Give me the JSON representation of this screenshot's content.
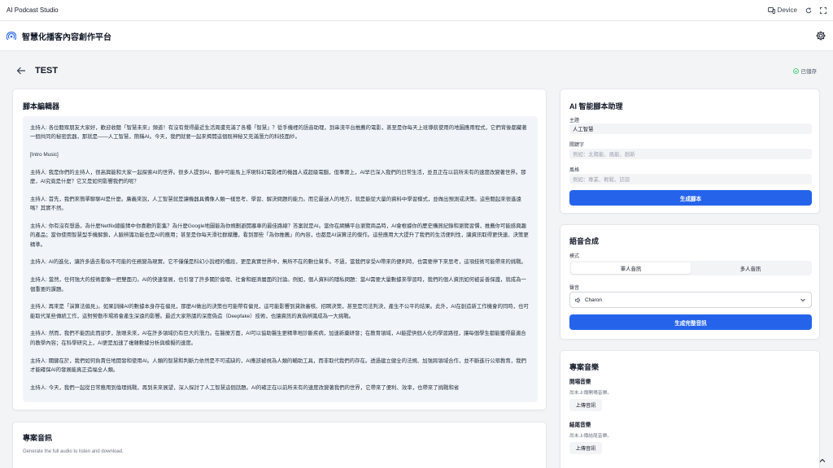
{
  "window": {
    "app_title": "AI Podcast Studio",
    "device_label": "Device"
  },
  "header": {
    "brand": "智慧化播客內容創作平台"
  },
  "page": {
    "title": "TEST",
    "saved": "已儲存"
  },
  "editor": {
    "heading": "腳本編輯器",
    "paragraphs": [
      "主持人: 各位聽眾朋友大家好，歡迎收聽「智慧未來」頻道！有沒有覺得最近生活周遭充滿了各種「智慧」？從手機裡的語音助理，到串流平台推薦的電影，甚至是你每天上班導航使用的地圖應用程式，它們背後都藏著一個共同的秘密武器，那就是——人工智慧，簡稱AI。今天，我們就要一起來揭開這個既神秘又充滿潛力的科技面紗。",
      "[Intro Music]",
      "主持人: 我是你們的主持人，很高興能和大家一起探索AI的世界。很多人提到AI，腦中可能馬上浮現科幻電影裡的機器人或超級電腦，但事實上，AI早已深入我們的日常生活，並且正在以前所未有的速度改變著世界。那麼，AI究竟是什麼？它又是如何影響我們的呢？",
      "主持人: 首先，我們來簡單聊聊AI是什麼。廣義來說，人工智慧就是讓機器具備像人類一樣思考、學習、解決問題的能力。而它最迷人的地方，就是能從大量的資料中學習模式，並做出預測或決策。這些聽起來很遙遠嗎？其實不然。",
      "主持人: 你有沒有想過，為什麼Netflix總能猜中你喜歡的影集？為什麼Google地圖能為你規劃避開塞車的最佳路線？答案就是AI。當你在網購平台瀏覽商品時，AI會根據你的歷史購買紀錄和瀏覽習慣，推薦你可能感興趣的產品；當你使用智慧型手機解鎖，人臉辨識功能也是AI的應用；甚至是你每天滑社群媒體，看到那些「為你推薦」的內容，也都是AI演算法的傑作。這些應用大大提升了我們的生活便利性，讓資訊取得更快速、決策更精準。",
      "主持人: AI的進化，讓許多過去看似不可能的任務變為現實。它不僅僅是科幻小說裡的橋段，更是真實世界中，無所不在的數位幫手。不過，當我們享受AI帶來的便利時，也需要停下來思考，這項技術可能帶來的挑戰。",
      "主持人: 當然，任何強大的技術都像一把雙面刃。AI的快速發展，也引發了許多關於倫理、社會和經濟層面的討論。例如，個人資料的隱私問題：當AI需要大量數據來學習時，我們的個人資訊如何被妥善保護，就成為一個重要的課題。",
      "主持人: 再來是「演算法偏見」。如果訓練AI的數據本身存在偏見，那麼AI做出的決策也可能帶有偏見，這可能影響到貸款審核、招聘決策，甚至是司法判決，產生不公平的結果。此外，AI在創造新工作機會的同時，也可能取代某些傳統工作，這對勞動市場將會產生深遠的影響。最近大家熟議的深度偽造（Deepfake）技術，也讓資訊的真偽辨識成為一大挑戰。",
      "主持人: 然而，我們不能因此而卻步，放眼未來，AI在許多領域仍有巨大的潛力。在醫療方面，AI可以協助醫生更精準地診斷疾病，加速新藥研發；在教育領域，AI能提供個人化的學習路徑，讓每個學生都能獲得最適合的教學內容；在科學研究上，AI更是加速了複雜數據分析與模擬的速度。",
      "主持人: 關鍵在於，我們如何負責任地開發和使用AI。人類的智慧和判斷力依然是不可或缺的，AI應該被視為人類的輔助工具，而非取代我們的存在。透過建立健全的法規、加強跨領域合作，並不斷進行公眾教育，我們才能確保AI的發展能真正造福全人類。",
      "主持人: 今天，我們一起從日常應用到倫理挑戰，再到未來展望，深入探討了人工智慧這個話題。AI的確正在以前所未有的速度改變著我們的世界，它帶來了便利、效率，也帶來了挑戰和省"
    ]
  },
  "project_audio": {
    "heading": "專案音訊",
    "subtitle": "Generate the full audio to listen and download."
  },
  "assistant": {
    "heading": "AI 智能腳本助理",
    "topic_label": "主題",
    "topic_value": "人工智慧",
    "keywords_label": "關鍵字",
    "keywords_placeholder": "例如：太陽能、風能、創新",
    "style_label": "風格",
    "style_placeholder": "例如：專業、輕鬆、訪談",
    "generate_button": "生成腳本"
  },
  "tts": {
    "heading": "語音合成",
    "mode_label": "模式",
    "mode_single": "單人音訊",
    "mode_multi": "多人音訊",
    "voice_label": "聲音",
    "voice_value": "Charon",
    "generate_button": "生成完整音訊"
  },
  "music": {
    "heading": "專案音樂",
    "intro_label": "開場音樂",
    "intro_status": "尚未上傳開場音樂。",
    "intro_upload": "上傳音訊",
    "outro_label": "結尾音樂",
    "outro_status": "尚未上傳結尾音樂。",
    "outro_upload": "上傳音訊"
  },
  "colors": {
    "accent": "#2563eb",
    "saved_green": "#22c55e"
  }
}
